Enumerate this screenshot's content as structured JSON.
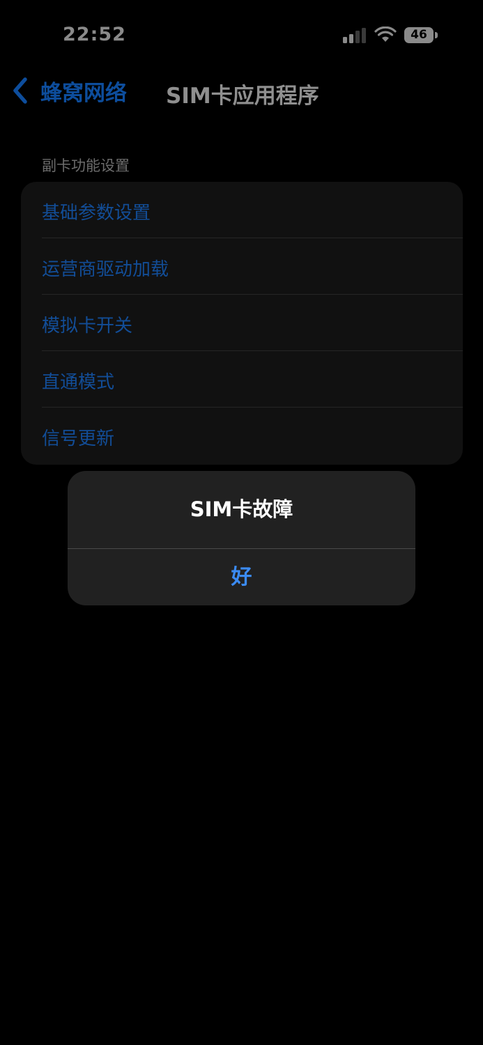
{
  "status_bar": {
    "time": "22:52",
    "battery_level": "46",
    "signal_icon": "cellular-signal-icon",
    "wifi_icon": "wifi-icon"
  },
  "nav": {
    "back_label": "蜂窝网络",
    "back_icon": "chevron-left-icon",
    "title": "SIM卡应用程序"
  },
  "section": {
    "header": "副卡功能设置",
    "items": [
      {
        "label": "基础参数设置"
      },
      {
        "label": "运营商驱动加载"
      },
      {
        "label": "模拟卡开关"
      },
      {
        "label": "直通模式"
      },
      {
        "label": "信号更新"
      }
    ]
  },
  "alert": {
    "title": "SIM卡故障",
    "ok_label": "好"
  },
  "colors": {
    "background": "#000000",
    "link_dim": "#124d97",
    "alert_button": "#3b8bf3",
    "alert_bg": "#212121",
    "group_bg": "#111111"
  }
}
